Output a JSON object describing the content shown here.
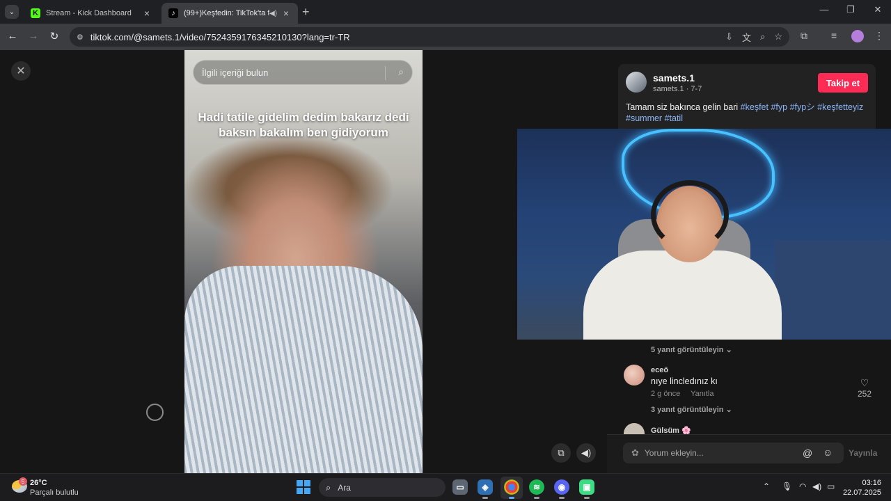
{
  "browser": {
    "tabs": [
      {
        "title": "Stream - Kick Dashboard",
        "active": false,
        "favicon": "kick-logo"
      },
      {
        "title": "(99+)Keşfedin: TikTok'ta fav",
        "active": true,
        "favicon": "tiktok-logo"
      }
    ],
    "url": "tiktok.com/@samets.1/video/7524359176345210130?lang=tr-TR",
    "accent_color": "#3c3d41"
  },
  "viewer": {
    "search_placeholder": "İlgili içeriği bulun",
    "caption": "Hadi tatile gidelim dedim bakarız dedi baksın bakalım ben gidiyorum"
  },
  "post": {
    "username": "samets.1",
    "handle": "samets.1",
    "date": "7-7",
    "follow_label": "Takip et",
    "follow_color": "#fe2c55",
    "description_text": "Tamam siz bakınca gelin bari",
    "hashtags": [
      "#keşfet",
      "#fyp",
      "#fypシ",
      "#keşfetteyiz",
      "#summer",
      "#tatil"
    ]
  },
  "comments": {
    "replies_first": "5 yanıt görüntüleyin",
    "comment": {
      "user": "eceö",
      "text": "nıye lincledınız kı",
      "time": "2 g önce",
      "reply_label": "Yanıtla",
      "likes": "252"
    },
    "replies_second": "3 yanıt görüntüleyin",
    "next_user": "Gülsüm 🌸",
    "input_placeholder": "Yorum ekleyin...",
    "post_label": "Yayınla"
  },
  "taskbar": {
    "weather_badge": "5",
    "temperature": "26°C",
    "weather": "Parçalı bulutlu",
    "search_label": "Ara",
    "time": "03:16",
    "date": "22.07.2025"
  }
}
